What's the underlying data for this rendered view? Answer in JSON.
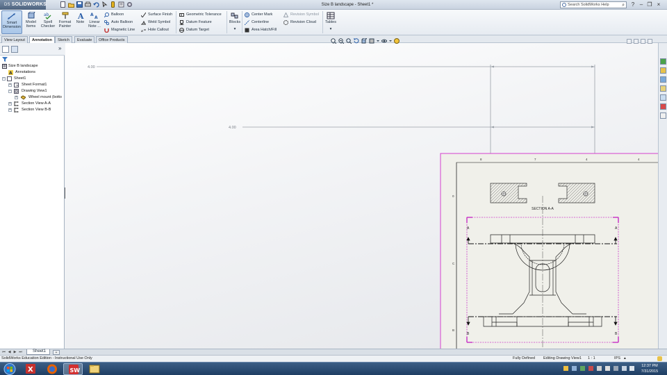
{
  "app": {
    "logo_prefix": "DS",
    "logo_text": "SOLIDWORKS",
    "window_title": "Size B landscape - Sheet1 *",
    "search_placeholder": "Search SolidWorks Help"
  },
  "ribbon": {
    "smart_dimension": [
      "Smart",
      "Dimension"
    ],
    "model_items": [
      "Model",
      "Items"
    ],
    "spell_checker": [
      "Spell",
      "Checker"
    ],
    "format_painter": [
      "Format",
      "Painter"
    ],
    "note": "Note",
    "linear_note": [
      "Linear",
      "Note ..."
    ],
    "col1": [
      "Balloon",
      "Auto Balloon",
      "Magnetic Line"
    ],
    "col2": [
      "Surface Finish",
      "Weld Symbol",
      "Hole Callout"
    ],
    "col3": [
      "Geometric Tolerance",
      "Datum Feature",
      "Datum Target"
    ],
    "blocks": "Blocks",
    "col4": [
      "Center Mark",
      "Centerline",
      "Area Hatch/Fill"
    ],
    "col5": [
      "Revision Symbol",
      "Revision Cloud"
    ],
    "tables": "Tables"
  },
  "tabs": [
    "View Layout",
    "Annotation",
    "Sketch",
    "Evaluate",
    "Office Products"
  ],
  "active_tab": "Annotation",
  "tree": {
    "root": "Size B landscape",
    "annotations": "Annotations",
    "sheet1": "Sheet1",
    "sheet_format": "Sheet Format1",
    "drawing_view": "Drawing View1",
    "wheel_mount": "Wheel mount (botto",
    "section_aa": "Section View A-A",
    "section_bb": "Section View B-B"
  },
  "drawing": {
    "dim_top": "4.00",
    "dim_mid": "4.00",
    "section_label": "SECTION A-A",
    "zone_top": [
      "8",
      "7",
      "4",
      "4"
    ],
    "zone_left": [
      "0",
      "C",
      "B"
    ],
    "cut_labels": [
      "A",
      "A",
      "B",
      "B"
    ]
  },
  "sheet_tab": "Sheet1",
  "status": {
    "edition": "SolidWorks Education Edition - Instructional Use Only",
    "state": "Fully Defined",
    "editing": "Editing Drawing View1",
    "scale": "1 : 1",
    "units": "IPS"
  },
  "clock": {
    "time": "12:37 PM",
    "date": "7/31/2015"
  }
}
